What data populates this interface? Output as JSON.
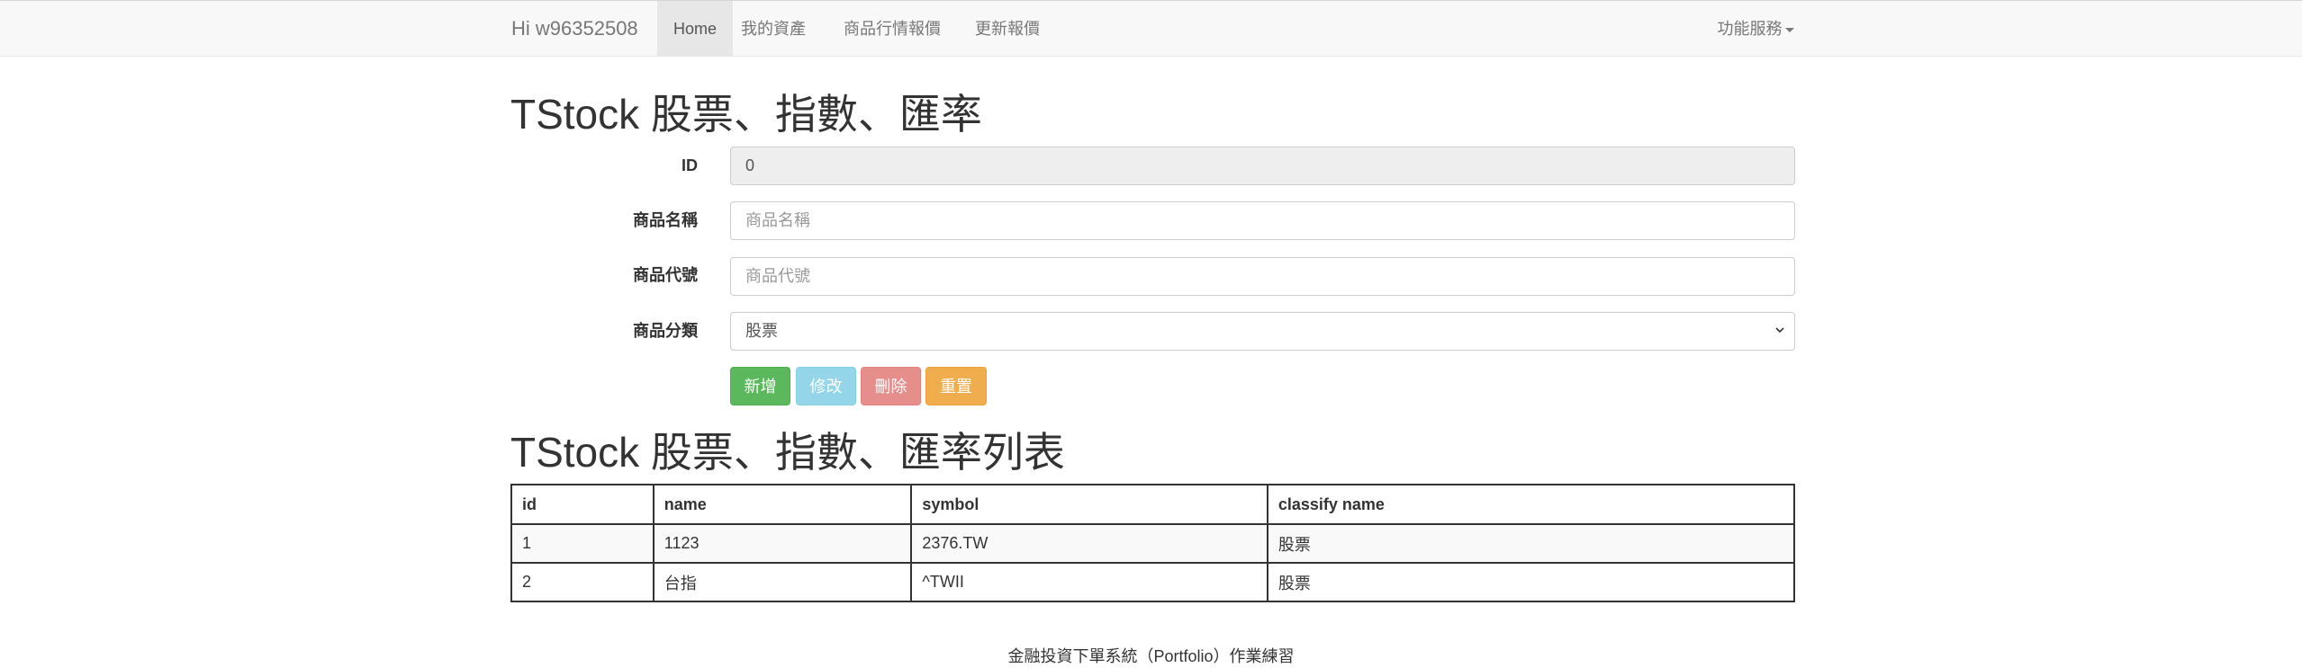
{
  "navbar": {
    "brand": "Hi w96352508",
    "items": [
      {
        "label": "Home",
        "active": true
      },
      {
        "label": "我的資產"
      },
      {
        "label": "商品行情報價"
      },
      {
        "label": "更新報價"
      }
    ],
    "right_menu": "功能服務"
  },
  "form_section": {
    "title": "TStock 股票、指數、匯率",
    "fields": {
      "id": {
        "label": "ID",
        "value": "0"
      },
      "name": {
        "label": "商品名稱",
        "placeholder": "商品名稱"
      },
      "symbol": {
        "label": "商品代號",
        "placeholder": "商品代號"
      },
      "classify": {
        "label": "商品分類",
        "selected": "股票"
      }
    },
    "buttons": {
      "add": "新增",
      "edit": "修改",
      "delete": "刪除",
      "reset": "重置"
    }
  },
  "list_section": {
    "title": "TStock 股票、指數、匯率列表",
    "columns": [
      "id",
      "name",
      "symbol",
      "classify name"
    ],
    "rows": [
      [
        "1",
        "1123",
        "2376.TW",
        "股票"
      ],
      [
        "2",
        "台指",
        "^TWII",
        "股票"
      ]
    ]
  },
  "footer": "金融投資下單系統（Portfolio）作業練習"
}
